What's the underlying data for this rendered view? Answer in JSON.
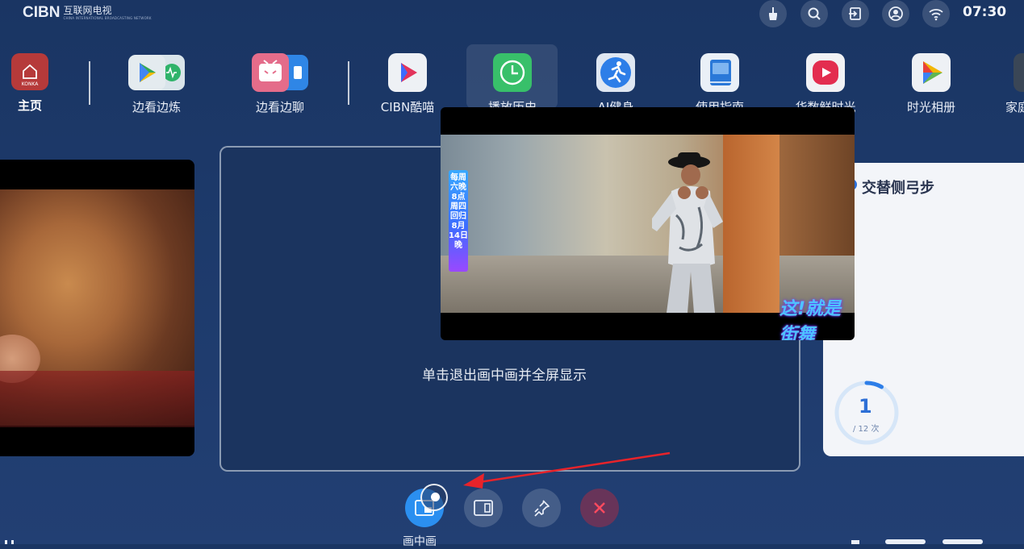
{
  "top_bar": {
    "logo_main": "CIBN",
    "logo_cn": "互联网电视",
    "logo_en": "CHINA INTERNATIONAL BROADCASTING NETWORK",
    "clock": "07:30",
    "icons": [
      "broom-icon",
      "search-icon",
      "input-source-icon",
      "user-icon",
      "wifi-icon"
    ]
  },
  "apps": [
    {
      "label": "主页",
      "sub": "KONKA",
      "icon": "home-icon"
    },
    {
      "label": "边看边炼",
      "icon": "play-store-icon"
    },
    {
      "label": "边看边聊",
      "icon": "chat-icon"
    },
    {
      "label": "CIBN酷喵",
      "icon": "kumiao-icon"
    },
    {
      "label": "播放历史",
      "icon": "clock-icon"
    },
    {
      "label": "AI健身",
      "icon": "fitness-icon"
    },
    {
      "label": "使用指南",
      "icon": "book-icon"
    },
    {
      "label": "华数鲜时光",
      "icon": "huashu-icon"
    },
    {
      "label": "时光相册",
      "icon": "album-icon"
    },
    {
      "label": "家庭",
      "icon": "family-icon"
    }
  ],
  "main_card": {
    "hint": "单击退出画中画并全屏显示"
  },
  "right_card": {
    "title": "交替侧弓步",
    "count": "1",
    "total": "/ 12 次",
    "progress_fraction": 0.0833
  },
  "video": {
    "side_tag": "每周六晚8点周四回归8月14日晚",
    "brand": "这!就是街舞"
  },
  "controls": {
    "pip_label": "画中画",
    "buttons": [
      "pip-icon",
      "split-screen-icon",
      "pin-icon",
      "close-icon"
    ]
  },
  "colors": {
    "background": "#1d3a6b",
    "accent": "#2b8ff0",
    "arrow": "#e8232a"
  }
}
